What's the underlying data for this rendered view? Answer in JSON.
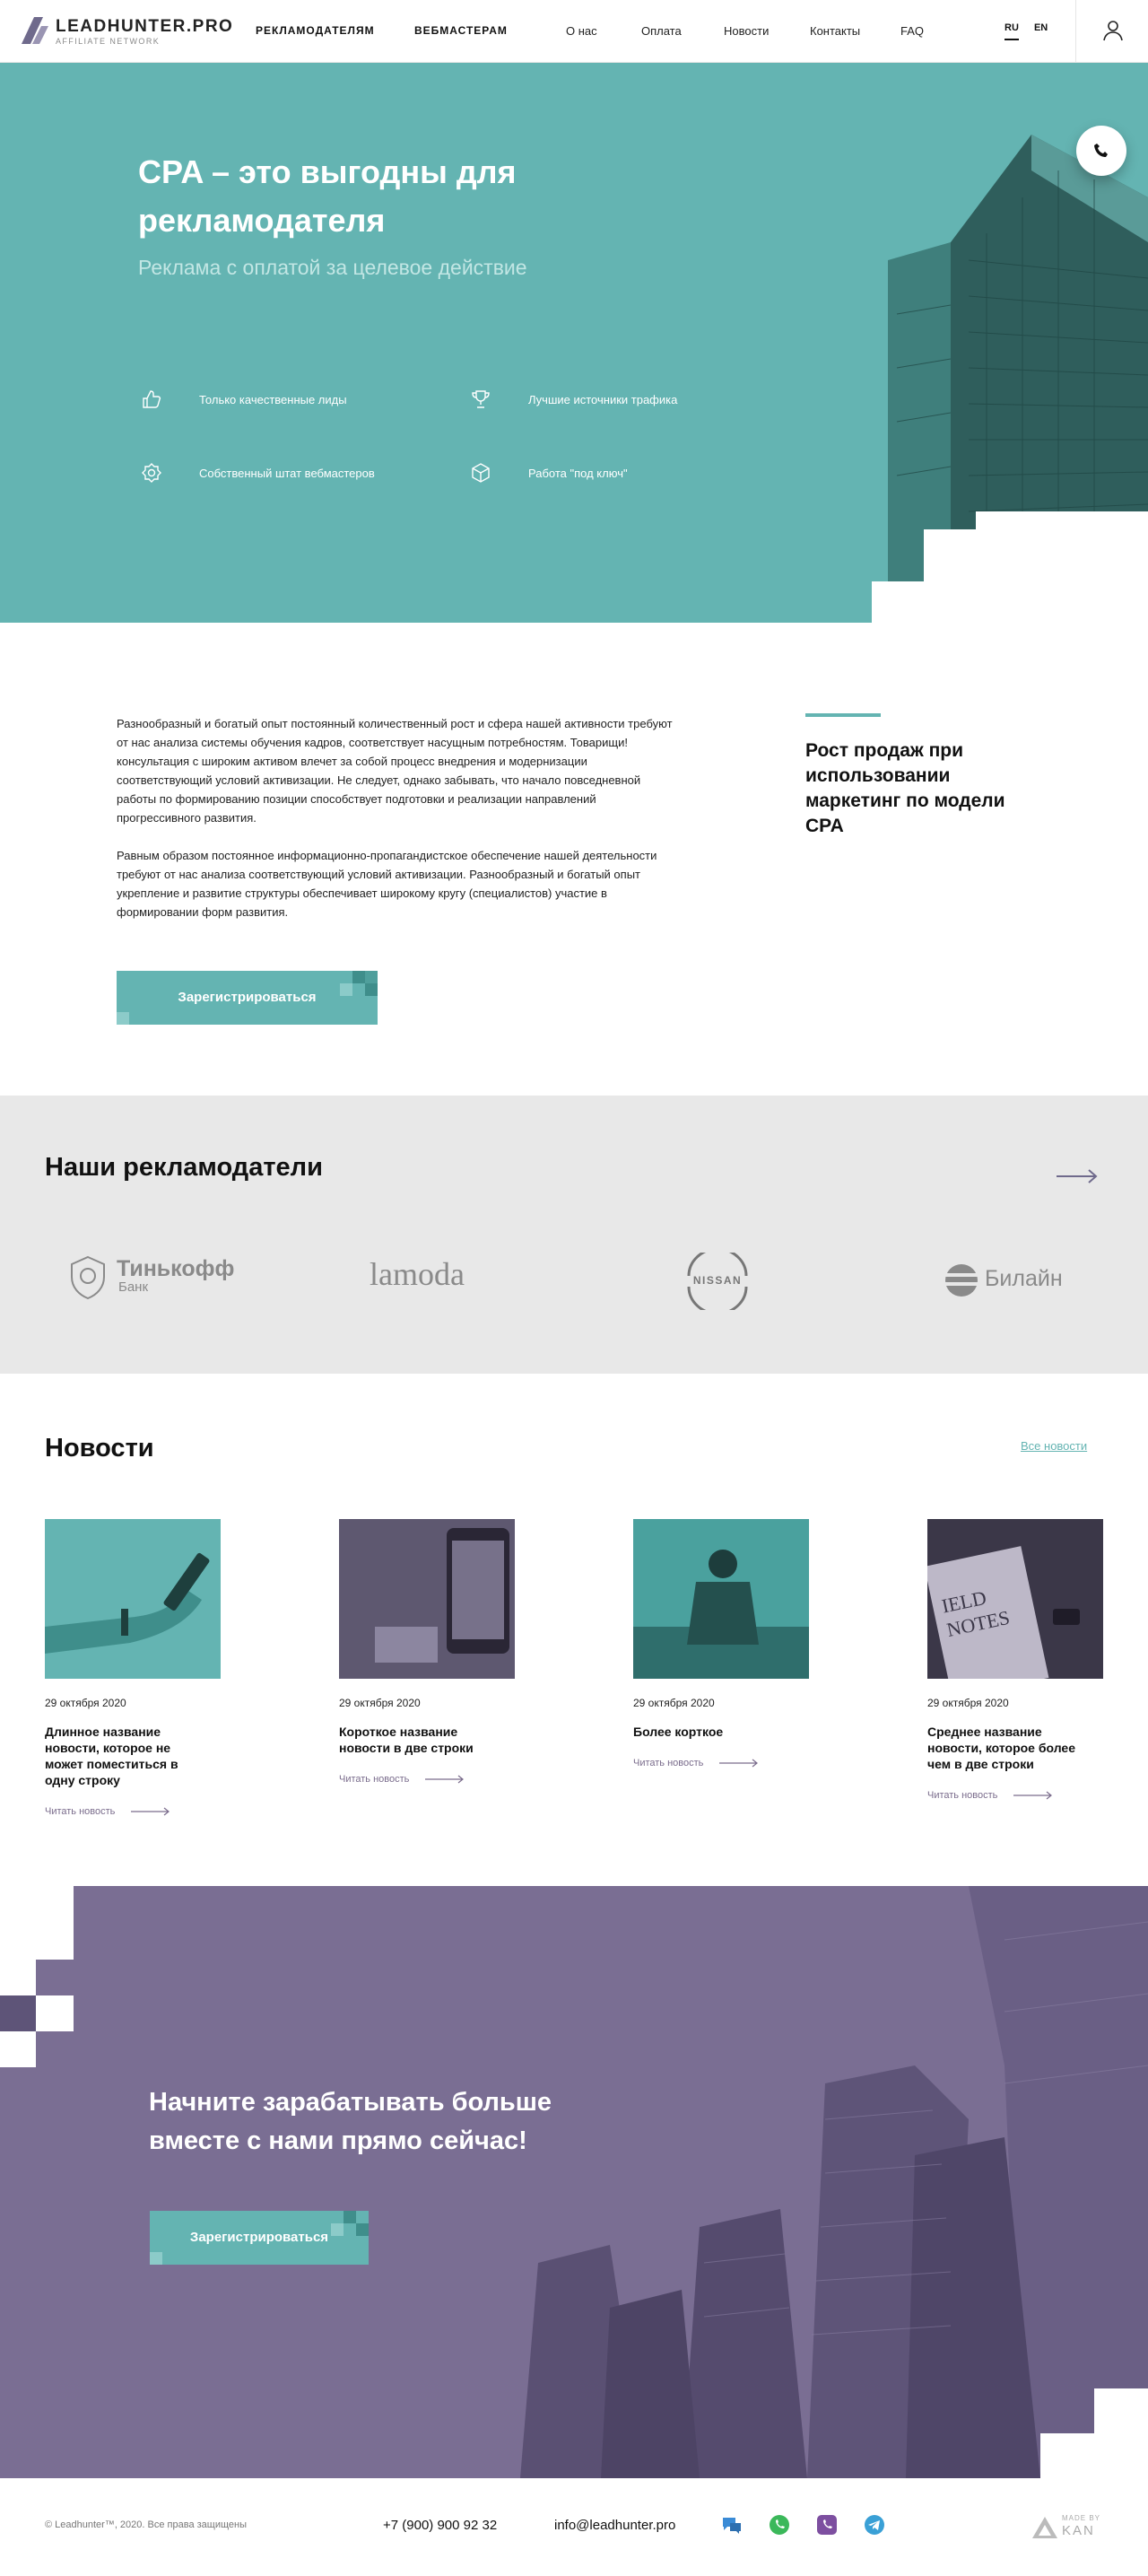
{
  "header": {
    "logo_text": "LEADHUNTER.PRO",
    "logo_sub": "AFFILIATE NETWORK",
    "main_nav": [
      "РЕКЛАМОДАТЕЛЯМ",
      "ВЕБМАСТЕРАМ"
    ],
    "nav": [
      "О нас",
      "Оплата",
      "Новости",
      "Контакты",
      "FAQ"
    ],
    "langs": [
      "RU",
      "EN"
    ],
    "active_lang": "RU"
  },
  "hero": {
    "title": "CPA – это выгодны для рекламодателя",
    "subtitle": "Реклама с оплатой за целевое действие",
    "features": [
      {
        "label": "Только качественные лиды",
        "icon": "thumbs-up-icon"
      },
      {
        "label": "Лучшие источники трафика",
        "icon": "trophy-icon"
      },
      {
        "label": "Собственный штат вебмастеров",
        "icon": "badge-icon"
      },
      {
        "label": "Работа \"под ключ\"",
        "icon": "box-icon"
      }
    ]
  },
  "about": {
    "paragraph1": "Разнообразный и богатый опыт постоянный количественный рост и сфера нашей активности требуют от нас анализа системы обучения кадров, соответствует насущным потребностям. Товарищи! консультация с широким активом влечет за собой процесс внедрения и модернизации соответствующий условий активизации. Не следует, однако забывать, что начало повседневной работы по формированию позиции способствует подготовки и реализации направлений прогрессивного развития.",
    "paragraph2": "Равным образом постоянное информационно-пропагандистское обеспечение нашей деятельности требуют от нас анализа соответствующий условий активизации. Разнообразный и богатый опыт укрепление и развитие структуры обеспечивает широкому кругу (специалистов) участие в формировании форм развития.",
    "side_title": "Рост продаж при использовании маркетинг по модели CPA",
    "register_button": "Зарегистрироваться"
  },
  "advertisers": {
    "title": "Наши рекламодатели",
    "brands": [
      {
        "name": "Тинькофф",
        "sub": "Банк"
      },
      {
        "name": "lamoda"
      },
      {
        "name": "NISSAN"
      },
      {
        "name": "Билайн"
      }
    ]
  },
  "news": {
    "title": "Новости",
    "all_link": "Все новости",
    "read_more": "Читать новость",
    "items": [
      {
        "date": "29 октября 2020",
        "title": "Длинное название новости, которое не может поместиться в одну строку"
      },
      {
        "date": "29 октября 2020",
        "title": "Короткое название новости в две строки"
      },
      {
        "date": "29 октября 2020",
        "title": "Более корткое"
      },
      {
        "date": "29 октября 2020",
        "title": "Среднее название новости, которое более чем в две строки"
      }
    ]
  },
  "cta": {
    "title": "Начните зарабатывать больше вместе с нами прямо сейчас!",
    "button": "Зарегистрироваться"
  },
  "footer": {
    "copyright": "© Leadhunter™, 2020. Все права защищены",
    "phone": "+7 (900) 900 92 32",
    "email": "info@leadhunter.pro",
    "made_by_label": "MADE BY",
    "made_by_name": "KAN"
  },
  "colors": {
    "teal": "#64b4b2",
    "purple": "#7a6e93",
    "light_gray": "#e8e8e8"
  }
}
